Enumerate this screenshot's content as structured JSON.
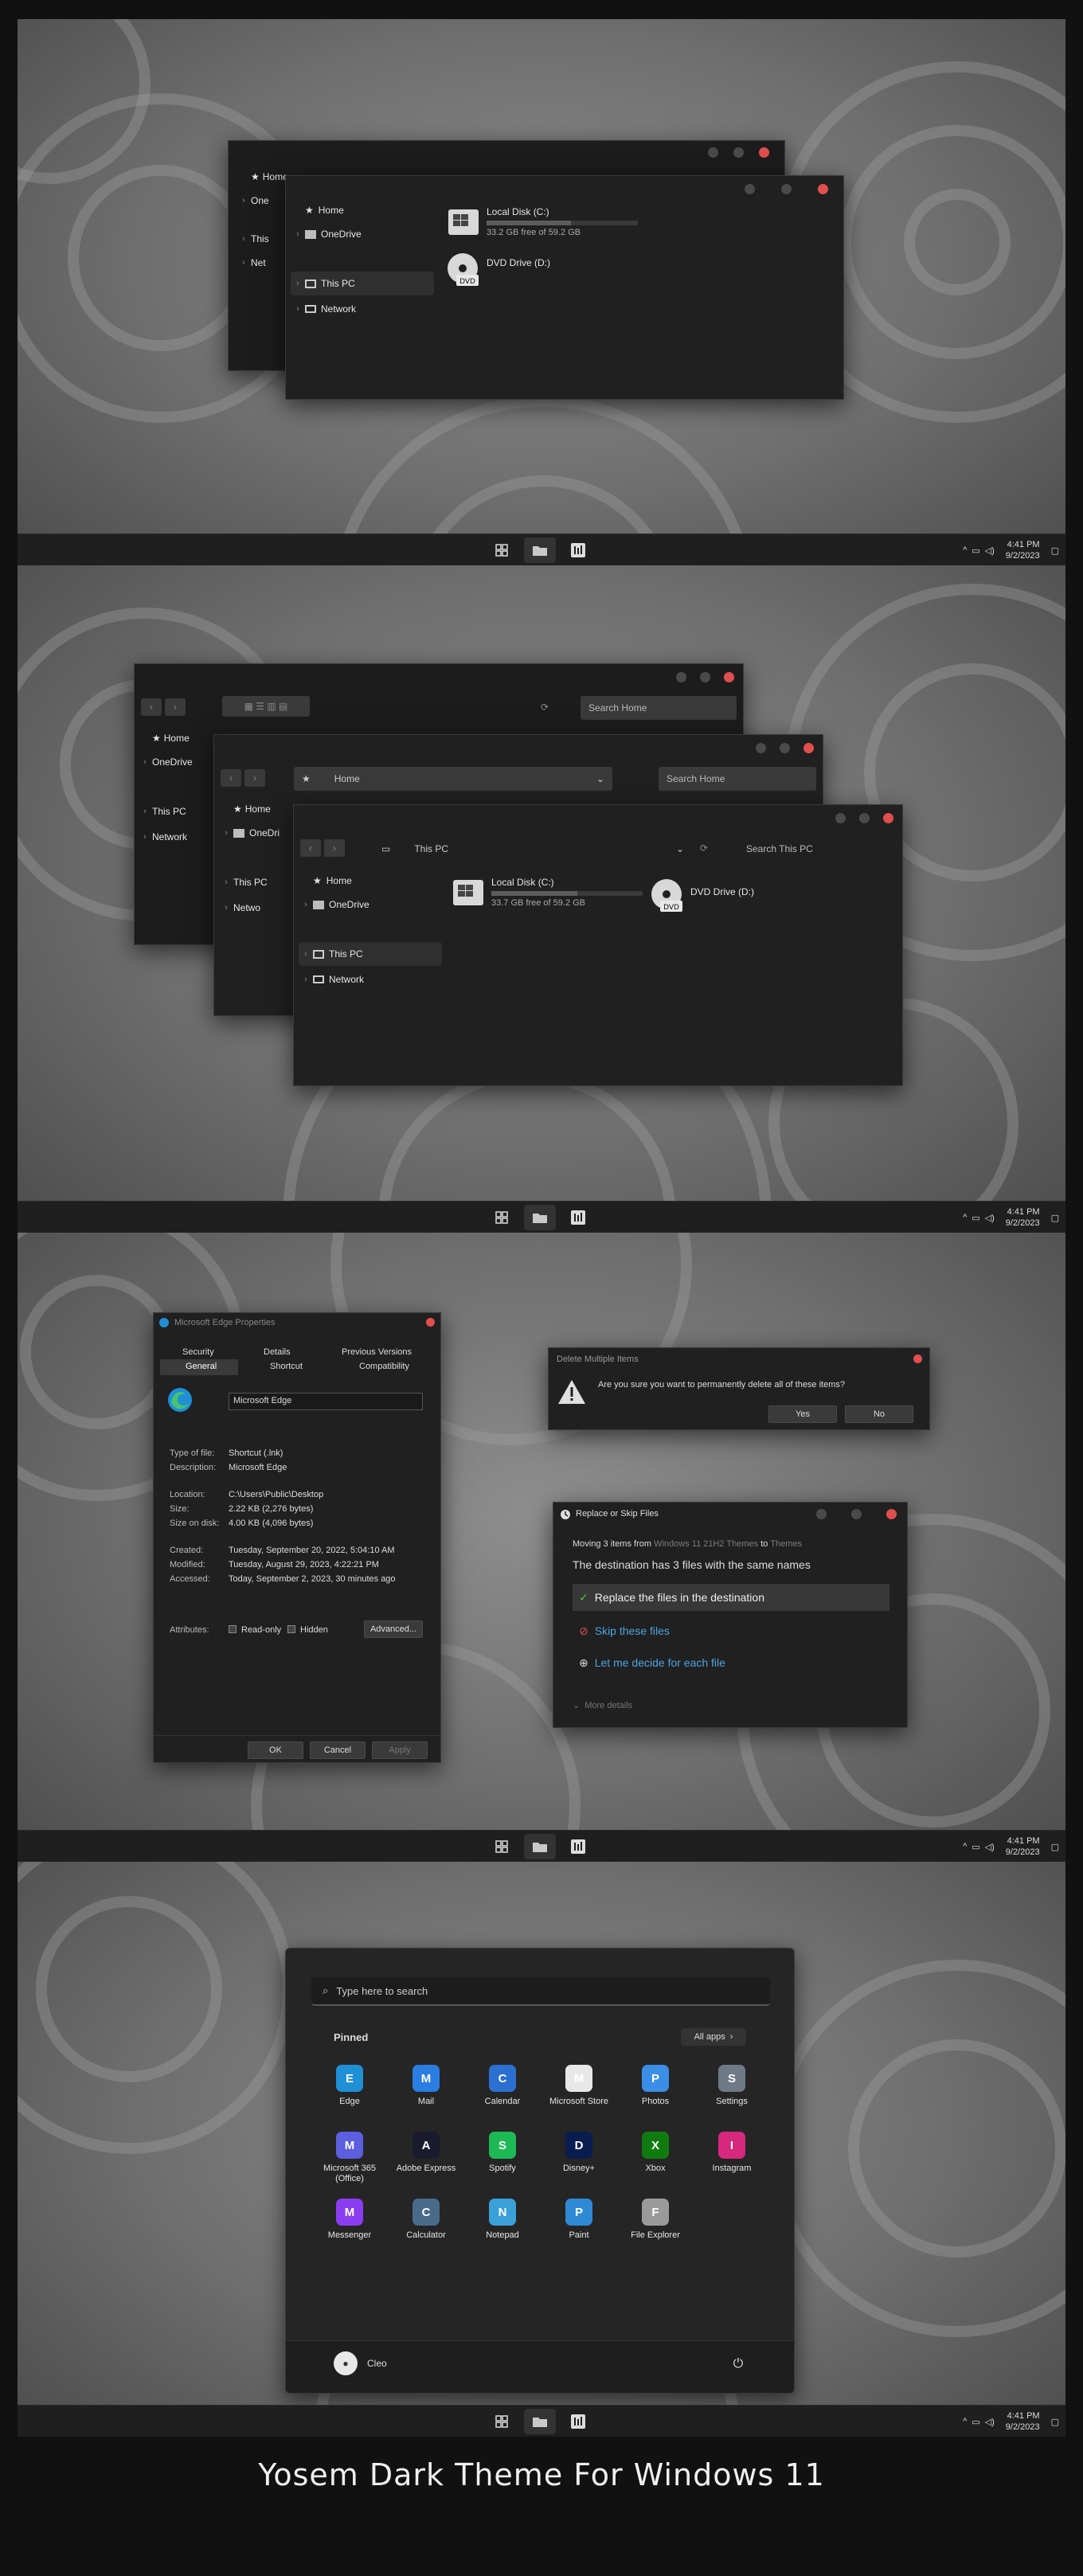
{
  "taskbar": {
    "time": "4:41 PM",
    "date": "9/2/2023",
    "icons": [
      "start-icon",
      "file-explorer-icon",
      "widgets-icon"
    ]
  },
  "panel1": {
    "back_window": {
      "nav": [
        "Home",
        "One",
        "This",
        "Net"
      ]
    },
    "front_window": {
      "nav": [
        "Home",
        "OneDrive",
        "This PC",
        "Network"
      ],
      "drives": [
        {
          "name": "Local Disk (C:)",
          "free": "33.2 GB free of 59.2 GB",
          "fill": 0.44
        },
        {
          "name": "DVD Drive (D:)"
        }
      ]
    }
  },
  "panel2": {
    "win_a": {
      "address": "",
      "search": "Search Home",
      "nav": [
        "Home",
        "OneDrive",
        "This PC",
        "Network"
      ]
    },
    "win_b": {
      "address": "Home",
      "search": "Search Home",
      "nav": [
        "Home",
        "OneDri",
        "This PC",
        "Netwo"
      ]
    },
    "win_c": {
      "address": "This PC",
      "search": "Search This PC",
      "nav": [
        "Home",
        "OneDrive",
        "This PC",
        "Network"
      ],
      "drives": [
        {
          "name": "Local Disk (C:)",
          "free": "33.7 GB free of 59.2 GB",
          "fill": 0.43
        },
        {
          "name": "DVD Drive (D:)"
        }
      ]
    }
  },
  "properties": {
    "title": "Microsoft Edge Properties",
    "tabs_row1": [
      "Security",
      "Details",
      "Previous Versions"
    ],
    "tabs_row2": [
      "General",
      "Shortcut",
      "Compatibility"
    ],
    "name": "Microsoft Edge",
    "rows": [
      {
        "label": "Type of file:",
        "value": "Shortcut (.lnk)"
      },
      {
        "label": "Description:",
        "value": "Microsoft Edge"
      },
      {
        "label": "Location:",
        "value": "C:\\Users\\Public\\Desktop"
      },
      {
        "label": "Size:",
        "value": "2.22 KB (2,276 bytes)"
      },
      {
        "label": "Size on disk:",
        "value": "4.00 KB (4,096 bytes)"
      },
      {
        "label": "Created:",
        "value": "Tuesday, September 20, 2022, 5:04:10 AM"
      },
      {
        "label": "Modified:",
        "value": "Tuesday, August 29, 2023, 4:22:21 PM"
      },
      {
        "label": "Accessed:",
        "value": "Today, September 2, 2023, 30 minutes ago"
      }
    ],
    "attributes_label": "Attributes:",
    "readonly": "Read-only",
    "hidden": "Hidden",
    "advanced": "Advanced...",
    "ok": "OK",
    "cancel": "Cancel",
    "apply": "Apply"
  },
  "delete_dialog": {
    "title": "Delete Multiple Items",
    "message": "Are you sure you want to permanently delete all of these items?",
    "yes": "Yes",
    "no": "No"
  },
  "replace_dialog": {
    "title": "Replace or Skip Files",
    "moving_prefix": "Moving 3 items from ",
    "source": "Windows 11 21H2 Themes",
    "to": " to ",
    "dest": "Themes",
    "headline": "The destination has 3 files with the same names",
    "options": [
      "Replace the files in the destination",
      "Skip these files",
      "Let me decide for each file"
    ],
    "more": "More details"
  },
  "start": {
    "search_placeholder": "Type here to search",
    "pinned": "Pinned",
    "all_apps": "All apps",
    "apps": [
      {
        "name": "Edge",
        "icon": "edge-icon",
        "color": "#1f8fd6"
      },
      {
        "name": "Mail",
        "icon": "mail-icon",
        "color": "#2a7de1"
      },
      {
        "name": "Calendar",
        "icon": "calendar-icon",
        "color": "#2b6fd1"
      },
      {
        "name": "Microsoft Store",
        "icon": "store-icon",
        "color": "#e8e8e8"
      },
      {
        "name": "Photos",
        "icon": "photos-icon",
        "color": "#3a8ee6"
      },
      {
        "name": "Settings",
        "icon": "settings-icon",
        "color": "#6f7a86"
      },
      {
        "name": "Microsoft 365 (Office)",
        "icon": "office-icon",
        "color": "#5b5fe0"
      },
      {
        "name": "Adobe Express",
        "icon": "adobe-express-icon",
        "color": "#1b1b2e"
      },
      {
        "name": "Spotify",
        "icon": "spotify-icon",
        "color": "#1db954"
      },
      {
        "name": "Disney+",
        "icon": "disney-icon",
        "color": "#0a1d4f"
      },
      {
        "name": "Xbox",
        "icon": "xbox-icon",
        "color": "#107c10"
      },
      {
        "name": "Instagram",
        "icon": "instagram-icon",
        "color": "#d6287d"
      },
      {
        "name": "Messenger",
        "icon": "messenger-icon",
        "color": "#8a3df0"
      },
      {
        "name": "Calculator",
        "icon": "calculator-icon",
        "color": "#4a6a8a"
      },
      {
        "name": "Notepad",
        "icon": "notepad-icon",
        "color": "#3aa0d8"
      },
      {
        "name": "Paint",
        "icon": "paint-icon",
        "color": "#2f8ad6"
      },
      {
        "name": "File Explorer",
        "icon": "folder-icon",
        "color": "#9a9a9a"
      }
    ],
    "user": "Cleo"
  },
  "caption": "Yosem Dark Theme For Windows 11"
}
